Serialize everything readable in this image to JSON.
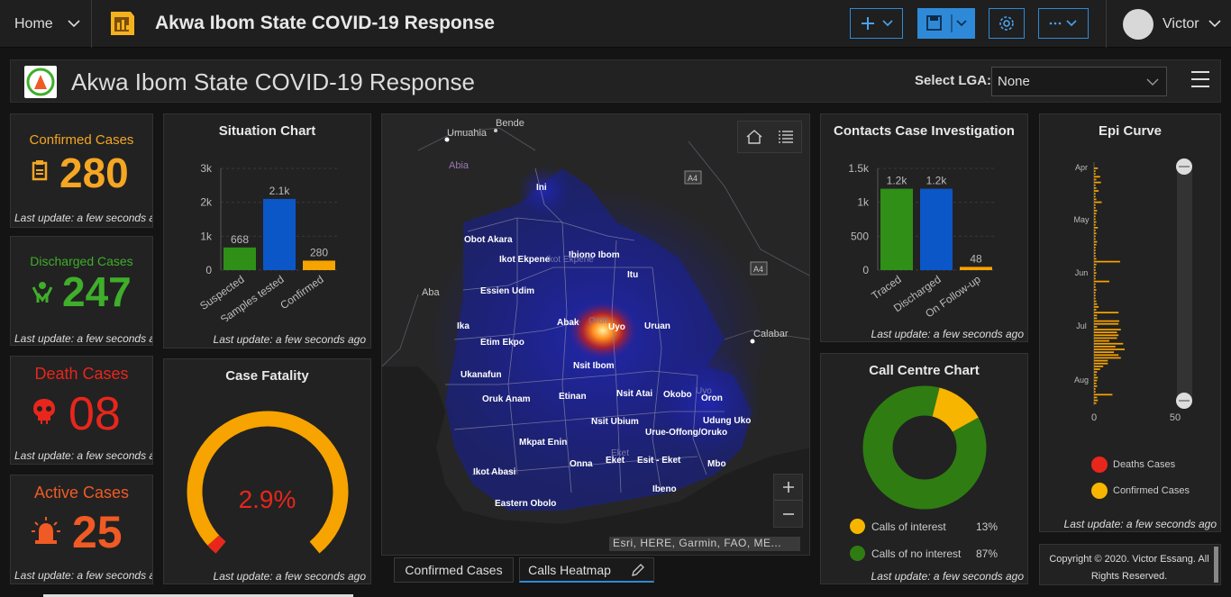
{
  "topbar": {
    "home_label": "Home",
    "title": "Akwa Ibom State COVID-19 Response",
    "user_name": "Victor",
    "accent": "#2e8ad8"
  },
  "header": {
    "title": "Akwa Ibom State COVID-19 Response",
    "lga_label": "Select LGA:",
    "lga_value": "None"
  },
  "cards": [
    {
      "title": "Confirmed Cases",
      "value": "280",
      "color": "#f5a623",
      "update": "Last update: a few seconds ago",
      "icon": "clipboard-icon"
    },
    {
      "title": "Discharged Cases",
      "value": "247",
      "color": "#3fae2a",
      "update": "Last update: a few seconds ago",
      "icon": "people-icon"
    },
    {
      "title": "Death Cases",
      "value": "08",
      "color": "#e8261c",
      "update": "Last update: a few seconds ago",
      "icon": "skull-icon"
    },
    {
      "title": "Active Cases",
      "value": "25",
      "color": "#f05a24",
      "update": "Last update: a few seconds ago",
      "icon": "siren-icon"
    }
  ],
  "situation": {
    "title": "Situation Chart",
    "update": "Last update: a few seconds ago",
    "chart_data": {
      "type": "bar",
      "categories": [
        "Suspected",
        "Samples tested",
        "Confirmed"
      ],
      "values": [
        668,
        2100,
        280
      ],
      "value_labels": [
        "668",
        "2.1k",
        "280"
      ],
      "colors": [
        "#2f8f17",
        "#0b57c8",
        "#f7a300"
      ],
      "yticks": [
        "0",
        "1k",
        "2k",
        "3k"
      ],
      "ylim": [
        0,
        3000
      ]
    }
  },
  "fatality": {
    "title": "Case Fatality",
    "value": "2.9%",
    "fraction": 0.029,
    "update": "Last update: a few seconds ago"
  },
  "map": {
    "attribution": "Esri, HERE, Garmin, FAO, ME...",
    "places": [
      "Bende",
      "Umuahia",
      "Abia",
      "A4",
      "A4",
      "Aba",
      "Calabar",
      "Oron",
      "Eket",
      "Uyo",
      "Ikot Ekpene"
    ],
    "lgas": [
      "Ini",
      "Obot Akara",
      "Ikot Ekpene",
      "Ibiono Ibom",
      "Itu",
      "Essien Udim",
      "Ika",
      "Abak",
      "Uyo",
      "Uruan",
      "Etim Ekpo",
      "Nsit Ibom",
      "Ukanafun",
      "Oruk Anam",
      "Etinan",
      "Nsit Atai",
      "Okobo",
      "Oron",
      "Nsit Ubium",
      "Udung Uko",
      "Urue-Offong/Oruko",
      "Mkpat Enin",
      "Onna",
      "Eket",
      "Esit - Eket",
      "Mbo",
      "Ikot Abasi",
      "Ibeno",
      "Eastern Obolo"
    ]
  },
  "tabs": [
    "Confirmed Cases",
    "Calls Heatmap"
  ],
  "contacts": {
    "title": "Contacts Case Investigation",
    "update": "Last update: a few seconds ago",
    "chart_data": {
      "type": "bar",
      "categories": [
        "Traced",
        "Discharged",
        "On Follow-up"
      ],
      "values": [
        1200,
        1200,
        48
      ],
      "value_labels": [
        "1.2k",
        "1.2k",
        "48"
      ],
      "colors": [
        "#2f8f17",
        "#0b57c8",
        "#f7a300"
      ],
      "yticks": [
        "0",
        "500",
        "1k",
        "1.5k"
      ],
      "ylim": [
        0,
        1500
      ]
    }
  },
  "callcentre": {
    "title": "Call Centre Chart",
    "update": "Last update: a few seconds ago",
    "chart_data": {
      "type": "pie",
      "labels": [
        "Calls of interest",
        "Calls of no interest"
      ],
      "values": [
        13,
        87
      ],
      "percent_labels": [
        "13%",
        "87%"
      ],
      "colors": [
        "#f7b500",
        "#2f7d12"
      ]
    }
  },
  "epi": {
    "title": "Epi Curve",
    "update": "Last update: a few seconds ago",
    "chart_data": {
      "type": "bar",
      "months": [
        "Apr",
        "May",
        "Jun",
        "Jul",
        "Aug"
      ],
      "xticks": [
        "0",
        "50"
      ],
      "legend": [
        "Deaths Cases",
        "Confirmed Cases"
      ],
      "colors": [
        "#e8261c",
        "#f7a300"
      ]
    }
  },
  "copyright": "Copyright © 2020. Victor Essang. All Rights Reserved."
}
